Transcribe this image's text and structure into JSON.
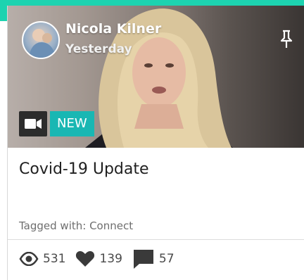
{
  "post": {
    "author_name": "Nicola Kilner",
    "time": "Yesterday",
    "badge_new": "NEW",
    "title": "Covid-19 Update",
    "tags_text": "Tagged with: Connect"
  },
  "stats": {
    "views": "531",
    "likes": "139",
    "comments": "57"
  },
  "icons": {
    "video": "video-camera-icon",
    "pin": "pin-icon",
    "views": "eye-icon",
    "likes": "heart-icon",
    "comments": "comment-icon"
  },
  "colors": {
    "accent_bar": "#1dd3b0",
    "new_badge": "#19b7b3"
  }
}
